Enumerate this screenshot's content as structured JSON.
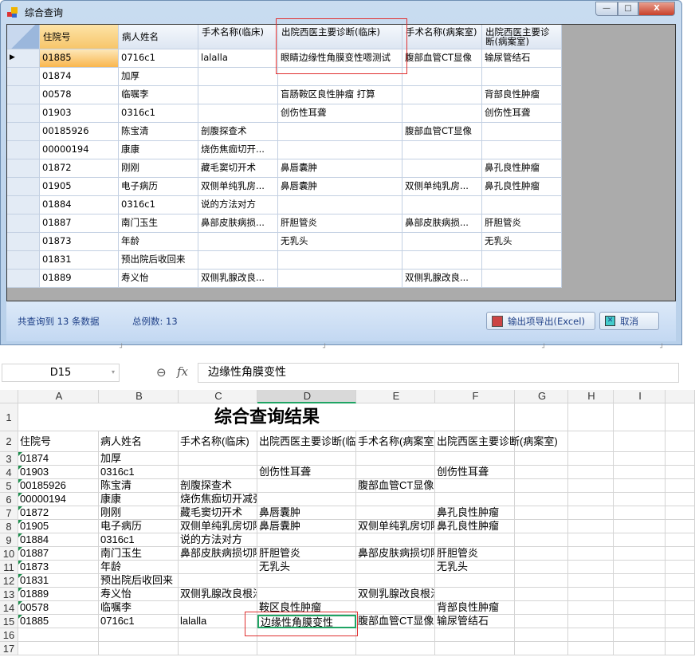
{
  "window": {
    "title": "综合查询",
    "minimize": "—",
    "maximize": "□",
    "close": "X"
  },
  "grid": {
    "columns": [
      "住院号",
      "病人姓名",
      "手术名称(临床)",
      "出院西医主要诊断(临床)",
      "手术名称(病案室)",
      "出院西医主要诊断(病案室)"
    ],
    "rows": [
      [
        "01885",
        "0716c1",
        "lalalla",
        "眼睛边缘性角膜变性嗯测试",
        "腹部血管CT显像",
        "输尿管结石"
      ],
      [
        "01874",
        "加厚",
        "",
        "",
        "",
        ""
      ],
      [
        "00578",
        "临嘱李",
        "",
        "盲肠鞍区良性肿瘤 打算",
        "",
        "背部良性肿瘤"
      ],
      [
        "01903",
        "0316c1",
        "",
        "创伤性耳聋",
        "",
        "创伤性耳聋"
      ],
      [
        "00185926",
        "陈宝清",
        "剖腹探查术",
        "",
        "腹部血管CT显像",
        ""
      ],
      [
        "00000194",
        "康康",
        "烧伤焦痂切开...",
        "",
        "",
        ""
      ],
      [
        "01872",
        "刚刚",
        "藏毛窦切开术",
        "鼻唇囊肿",
        "",
        "鼻孔良性肿瘤"
      ],
      [
        "01905",
        "电子病历",
        "双侧单纯乳房...",
        "鼻唇囊肿",
        "双侧单纯乳房...",
        "鼻孔良性肿瘤"
      ],
      [
        "01884",
        "0316c1",
        "说的方法对方",
        "",
        "",
        ""
      ],
      [
        "01887",
        "南门玉生",
        "鼻部皮肤病损...",
        "肝胆管炎",
        "鼻部皮肤病损...",
        "肝胆管炎"
      ],
      [
        "01873",
        "年龄",
        "",
        "无乳头",
        "",
        "无乳头"
      ],
      [
        "01831",
        "预出院后收回来",
        "",
        "",
        "",
        ""
      ],
      [
        "01889",
        "寿义怡",
        "双侧乳腺改良...",
        "",
        "双侧乳腺改良...",
        ""
      ]
    ],
    "selected_row": 0
  },
  "footer": {
    "count_text": "共查询到 13 条数据",
    "total_text": "总例数: 13",
    "export_button": "输出项导出(Excel)",
    "cancel_button": "取消"
  },
  "excel": {
    "name_box": "D15",
    "fx": "fx",
    "formula": "边缘性角膜变性",
    "col_headers": [
      "A",
      "B",
      "C",
      "D",
      "E",
      "F",
      "G",
      "H",
      "I"
    ],
    "selected_col": "D",
    "title": "综合查询结果",
    "header_row": [
      "住院号",
      "病人姓名",
      "手术名称(临床)",
      "出院西医主要诊断(临",
      "手术名称(病案室)",
      "出院西医主要诊断(病案室)"
    ],
    "rows": [
      [
        "01874",
        "加厚",
        "",
        "",
        "",
        ""
      ],
      [
        "01903",
        "0316c1",
        "",
        "创伤性耳聋",
        "",
        "创伤性耳聋"
      ],
      [
        "00185926",
        "陈宝清",
        "剖腹探查术",
        "",
        "腹部血管CT显像",
        ""
      ],
      [
        "00000194",
        "康康",
        "烧伤焦痂切开减张",
        "",
        "",
        ""
      ],
      [
        "01872",
        "刚刚",
        "藏毛窦切开术",
        "鼻唇囊肿",
        "",
        "鼻孔良性肿瘤"
      ],
      [
        "01905",
        "电子病历",
        "双侧单纯乳房切除",
        "鼻唇囊肿",
        "双侧单纯乳房切除",
        "鼻孔良性肿瘤"
      ],
      [
        "01884",
        "0316c1",
        "说的方法对方",
        "",
        "",
        ""
      ],
      [
        "01887",
        "南门玉生",
        "鼻部皮肤病损切除",
        "肝胆管炎",
        "鼻部皮肤病损切除",
        "肝胆管炎"
      ],
      [
        "01873",
        "年龄",
        "",
        "无乳头",
        "",
        "无乳头"
      ],
      [
        "01831",
        "预出院后收回来",
        "",
        "",
        "",
        ""
      ],
      [
        "01889",
        "寿义怡",
        "双侧乳腺改良根治",
        "",
        "双侧乳腺改良根治",
        ""
      ],
      [
        "00578",
        "临嘱李",
        "",
        "鞍区良性肿瘤",
        "",
        "背部良性肿瘤"
      ],
      [
        "01885",
        "0716c1",
        "lalalla",
        "边缘性角膜变性",
        "腹部血管CT显像",
        "输尿管结石"
      ]
    ],
    "row_numbers": [
      "1",
      "2",
      "3",
      "4",
      "5",
      "6",
      "7",
      "8",
      "9",
      "10",
      "11",
      "12",
      "13",
      "14",
      "15",
      "16",
      "17"
    ]
  },
  "colors": {
    "accent_green": "#1fa463",
    "highlight_red": "#e03030",
    "selected_orange": "#fbc56b"
  }
}
